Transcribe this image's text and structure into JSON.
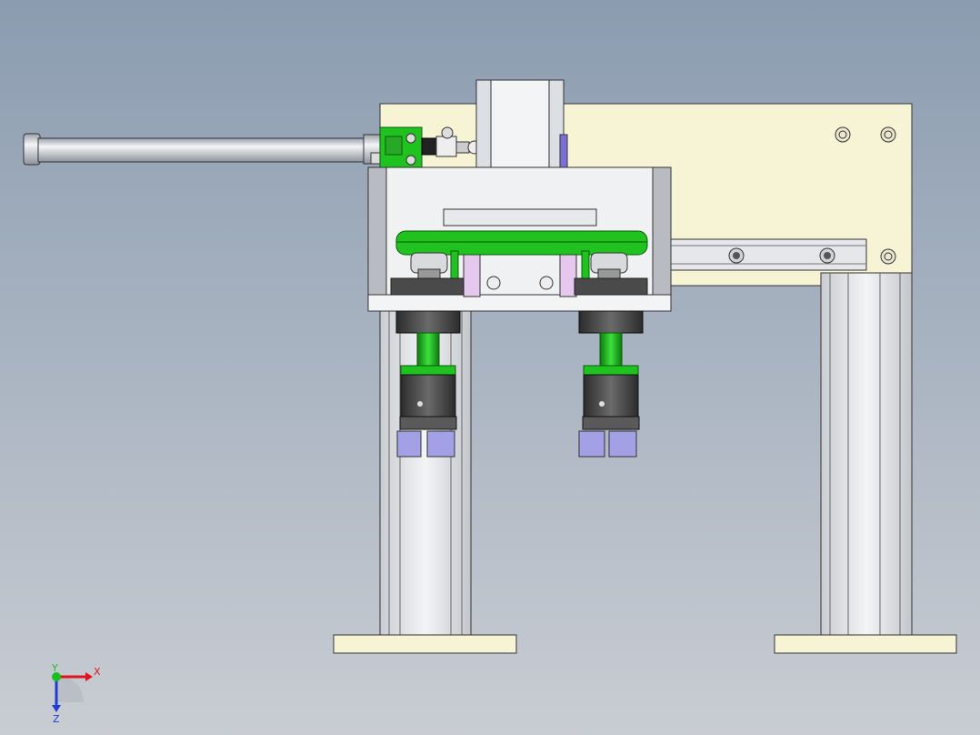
{
  "viewport": {
    "background_top": "#8b9cb0",
    "background_bottom": "#c9cdd3"
  },
  "model": {
    "colors": {
      "plate": "#f7f4d6",
      "aluminum": "#e2e4e8",
      "green": "#1fc21f",
      "dark": "#3a3a3a",
      "purple": "#a3a0e6",
      "pink": "#e6c8ee"
    }
  },
  "triad": {
    "x_label": "X",
    "y_label": "Y",
    "z_label": "Z",
    "x_color": "#e0141e",
    "y_color": "#17c21c",
    "z_color": "#1e3cd8"
  }
}
